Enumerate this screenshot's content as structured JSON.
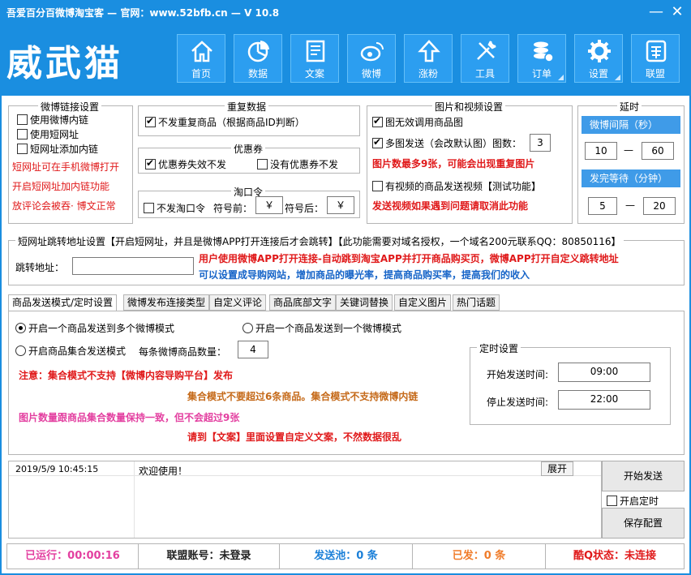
{
  "window": {
    "title": "吾爱百分百微博淘宝客 — 官网：www.52bfb.cn — V 10.8",
    "minimize": "—",
    "close": "✕"
  },
  "logo": "威武猫",
  "nav": [
    {
      "label": "首页",
      "icon": "home-icon"
    },
    {
      "label": "数据",
      "icon": "pie-chart-icon"
    },
    {
      "label": "文案",
      "icon": "document-icon"
    },
    {
      "label": "微博",
      "icon": "weibo-icon"
    },
    {
      "label": "涨粉",
      "icon": "arrow-up-icon"
    },
    {
      "label": "工具",
      "icon": "tools-icon"
    },
    {
      "label": "订单",
      "icon": "coins-icon"
    },
    {
      "label": "设置",
      "icon": "gear-icon"
    },
    {
      "label": "联盟",
      "icon": "alliance-icon"
    }
  ],
  "weibo_links": {
    "title": "微博链接设置",
    "use_inner": "使用微博内链",
    "use_short": "使用短网址",
    "short_add_inner": "短网址添加内链",
    "note1": "短网址可在手机微博打开",
    "note2": "开启短网址加内链功能",
    "note3": "放评论会被吞· 博文正常"
  },
  "repeat": {
    "title": "重复数据",
    "no_repeat": "不发重复商品（根据商品ID判断）"
  },
  "coupon": {
    "title": "优惠券",
    "invalid_skip": "优惠券失效不发",
    "no_coupon_skip": "没有优惠券不发"
  },
  "taokouling": {
    "title": "淘口令",
    "skip": "不发淘口令",
    "prefix_label": "符号前：",
    "prefix_value": "￥",
    "suffix_label": "符号后：",
    "suffix_value": "￥"
  },
  "images": {
    "title": "图片和视频设置",
    "use_product_img": "图无效调用商品图",
    "multi_img": "多图发送（会改默认图）图数：",
    "img_count": "3",
    "warn1": "图片数最多9张，可能会出现重复图片",
    "video": "有视频的商品发送视频【测试功能】",
    "warn2": "发送视频如果遇到问题请取消此功能"
  },
  "delay": {
    "title": "延时",
    "interval_label": "微博间隔（秒）",
    "interval_from": "10",
    "interval_to": "60",
    "wait_label": "发完等待（分钟）",
    "wait_from": "5",
    "wait_to": "20",
    "dash": "—"
  },
  "redirect": {
    "title": "短网址跳转地址设置【开启短网址，并且是微博APP打开连接后才会跳转】【此功能需要对域名授权，一个域名200元联系QQ：80850116】",
    "label": "跳转地址：",
    "value": "",
    "info1": "用户使用微博APP打开连接-自动跳到淘宝APP并打开商品购买页，微博APP打开自定义跳转地址",
    "info2": "可以设置成导购网站，增加商品的曝光率，提高商品购买率，提高我们的收入"
  },
  "tabs": [
    "商品发送模式/定时设置",
    "微博发布连接类型",
    "自定义评论",
    "商品底部文字",
    "关键词替换",
    "自定义图片",
    "热门话题"
  ],
  "mode": {
    "one_to_many": "开启一个商品发送到多个微博模式",
    "one_to_one": "开启一个商品发送到一个微博模式",
    "collection": "开启商品集合发送模式",
    "per_weibo_label": "每条微博商品数量：",
    "per_weibo_value": "4",
    "note1": "注意：集合模式不支持【微博内容导购平台】发布",
    "note2": "集合模式不要超过6条商品。集合模式不支持微博内链",
    "note3": "图片数量跟商品集合数量保持一致，但不会超过9张",
    "note4": "请到【文案】里面设置自定义文案，不然数据很乱"
  },
  "timer": {
    "title": "定时设置",
    "start_label": "开始发送时间:",
    "start_value": "09:00",
    "stop_label": "停止发送时间:",
    "stop_value": "22:00"
  },
  "log": {
    "time": "2019/5/9 10:45:15",
    "message": "欢迎使用！",
    "expand": "展开"
  },
  "actions": {
    "start": "开始发送",
    "timer_enable": "开启定时",
    "save": "保存配置"
  },
  "status": {
    "running": "已运行：00:00:16",
    "account": "联盟账号：未登录",
    "pool": "发送池：0 条",
    "sent": "已发：0 条",
    "kuq": "酷Q状态：未连接"
  },
  "colors": {
    "accent": "#1a8ee0",
    "red": "#e0191a",
    "blue": "#1664c8",
    "orange": "#c56a1a",
    "pink": "#e33fa0",
    "green": "#1a9e3a",
    "purple": "#8a2be2"
  }
}
